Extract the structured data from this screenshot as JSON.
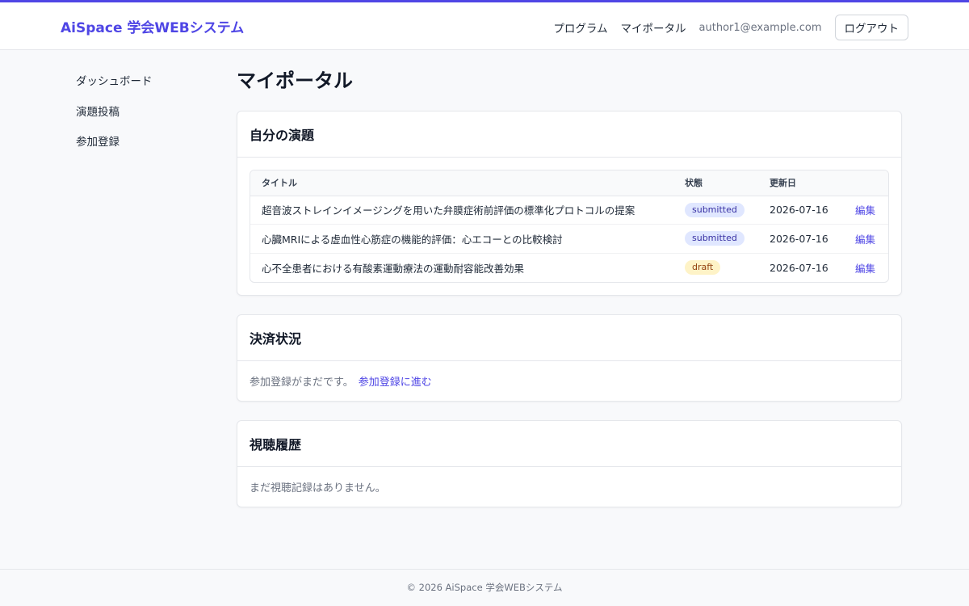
{
  "header": {
    "brand": "AiSpace 学会WEBシステム",
    "nav": {
      "program": "プログラム",
      "my_portal": "マイポータル",
      "email": "author1@example.com",
      "logout": "ログアウト"
    }
  },
  "sidebar": {
    "items": [
      {
        "label": "ダッシュボード"
      },
      {
        "label": "演題投稿"
      },
      {
        "label": "参加登録"
      }
    ]
  },
  "main": {
    "title": "マイポータル",
    "abstracts": {
      "heading": "自分の演題",
      "columns": {
        "title": "タイトル",
        "status": "状態",
        "updated": "更新日",
        "action": ""
      },
      "rows": [
        {
          "title": "超音波ストレインイメージングを用いた弁膜症術前評価の標準化プロトコルの提案",
          "status": "submitted",
          "updated": "2026-07-16",
          "action": "編集"
        },
        {
          "title": "心臓MRIによる虚血性心筋症の機能的評価：心エコーとの比較検討",
          "status": "submitted",
          "updated": "2026-07-16",
          "action": "編集"
        },
        {
          "title": "心不全患者における有酸素運動療法の運動耐容能改善効果",
          "status": "draft",
          "updated": "2026-07-16",
          "action": "編集"
        }
      ]
    },
    "payment": {
      "heading": "決済状況",
      "message": "参加登録がまだです。",
      "link": "参加登録に進む"
    },
    "history": {
      "heading": "視聴履歴",
      "message": "まだ視聴記録はありません。"
    }
  },
  "footer": {
    "text": "© 2026 AiSpace 学会WEBシステム"
  },
  "colors": {
    "accent": "#4f46e5",
    "badge_submitted_bg": "#e0e7ff",
    "badge_draft_bg": "#fef3c7"
  }
}
